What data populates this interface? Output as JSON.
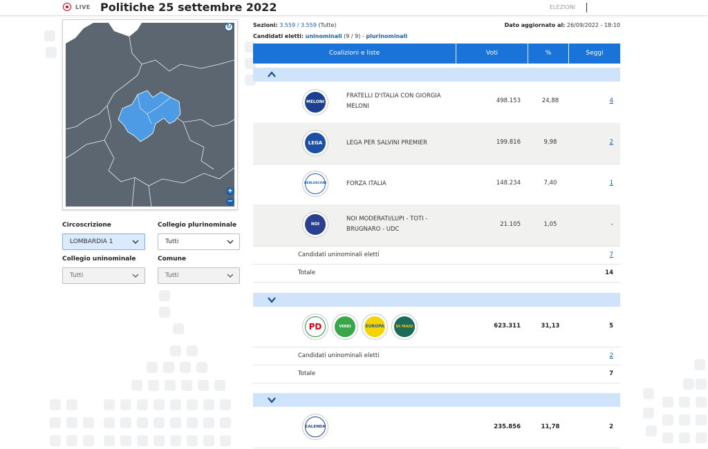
{
  "header": {
    "live_label": "LIVE",
    "title": "Politiche 25 settembre 2022",
    "right_label": "ELEZIONI"
  },
  "filters": {
    "circoscrizione_label": "Circoscrizione",
    "circoscrizione_value": "LOMBARDIA 1",
    "plurinominale_label": "Collegio plurinominale",
    "plurinominale_value": "Tutti",
    "uninominale_label": "Collegio uninominale",
    "uninominale_value": "Tutti",
    "comune_label": "Comune",
    "comune_value": "Tutti"
  },
  "info": {
    "sezioni_label": "Sezioni:",
    "sezioni_value": "3.559 / 3.559",
    "sezioni_suffix": "(Tutte)",
    "aggiornato_label": "Dato aggiornato al:",
    "aggiornato_value": "26/09/2022 - 18:10",
    "candidati_label": "Candidati eletti:",
    "uninominali_link": "uninominali",
    "uninominali_count": "(9 / 9) -",
    "plurinominali_link": "plurinominali"
  },
  "table": {
    "columns": [
      "Coalizioni e liste",
      "Voti",
      "%",
      "Seggi"
    ]
  },
  "coalition1": {
    "lists": [
      {
        "name": "FRATELLI D'ITALIA CON GIORGIA MELONI",
        "voti": "498.153",
        "perc": "24,88",
        "seggi": "4",
        "logo_text": "MELONI",
        "logo_color": "#1d3f8f"
      },
      {
        "name": "LEGA PER SALVINI PREMIER",
        "voti": "199.816",
        "perc": "9,98",
        "seggi": "2",
        "logo_text": "LEGA",
        "logo_color": "#1d4fa3"
      },
      {
        "name": "FORZA ITALIA",
        "voti": "148.234",
        "perc": "7,40",
        "seggi": "1",
        "logo_text": "BERLUSCONI",
        "logo_color": "#1f5fb5"
      },
      {
        "name": "NOI MODERATI/LUPI - TOTI - BRUGNARO - UDC",
        "voti": "21.105",
        "perc": "1,05",
        "seggi": "-",
        "logo_text": "NOI",
        "logo_color": "#2a3f8f"
      }
    ],
    "uninominali_label": "Candidati uninominali eletti",
    "uninominali_value": "7",
    "totale_label": "Totale",
    "totale_value": "14"
  },
  "coalition2": {
    "logos": [
      "PD",
      "VERDI",
      "EUROPA",
      "DI MAIO"
    ],
    "voti": "623.311",
    "perc": "31,13",
    "seggi": "5",
    "uninominali_label": "Candidati uninominali eletti",
    "uninominali_value": "2",
    "totale_label": "Totale",
    "totale_value": "7"
  },
  "coalition3": {
    "logo_text": "CALENDA",
    "voti": "235.856",
    "perc": "11,78",
    "seggi": "2"
  },
  "colors": {
    "primary": "#1a73d9",
    "group_bar": "#cfe3fb",
    "map_land": "#5b6670",
    "map_selected": "#4c9be4",
    "live_red": "#d0021b"
  }
}
